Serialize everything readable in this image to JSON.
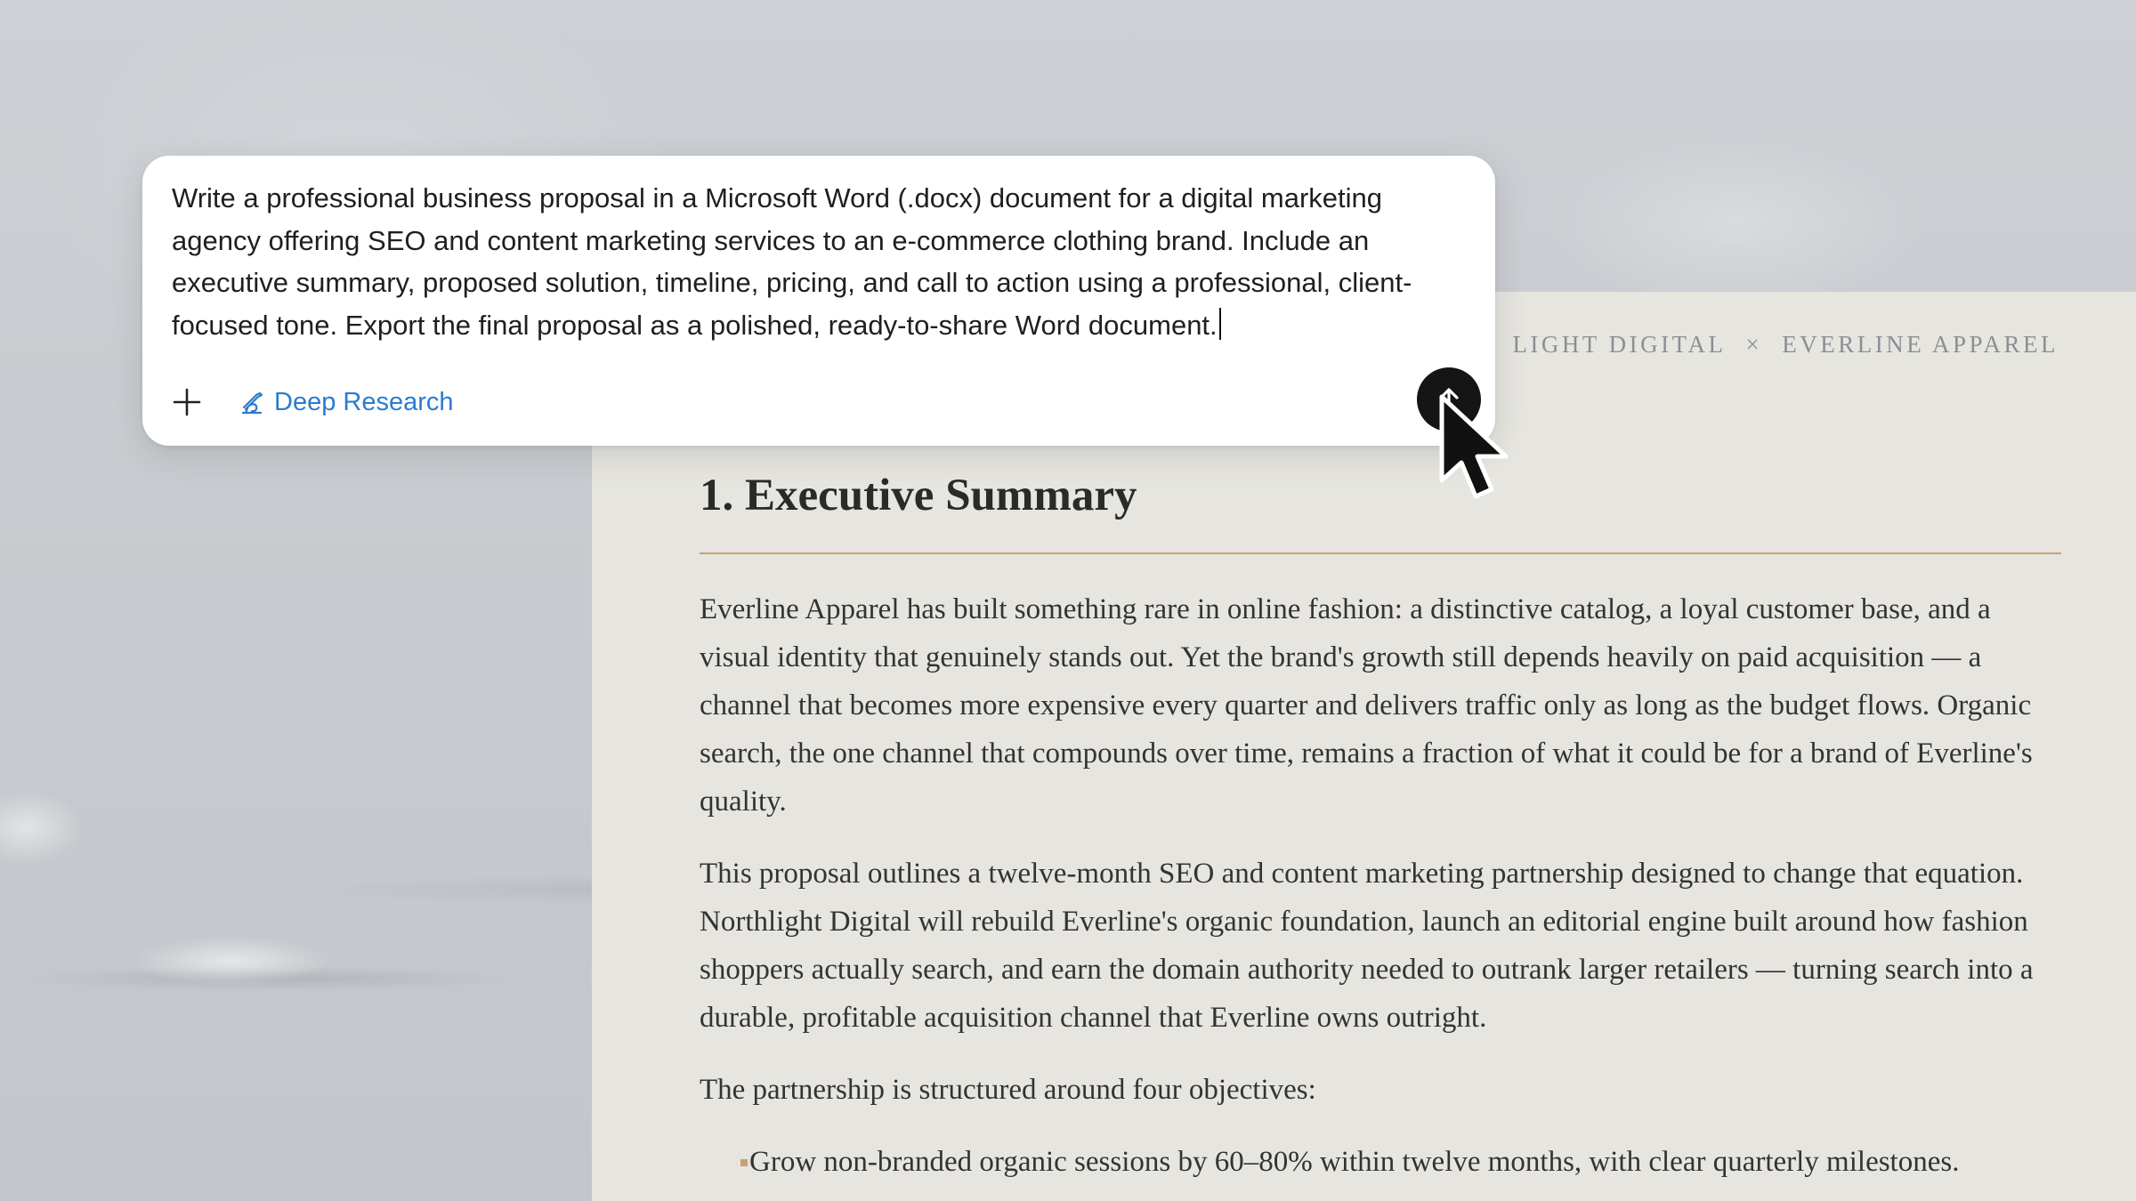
{
  "prompt": {
    "text": "Write a professional business proposal in a Microsoft Word (.docx) document for a digital marketing agency offering SEO and content marketing services to an e-commerce clothing brand. Include an executive summary, proposed solution, timeline, pricing, and call to action using a professional, client-focused tone. Export the final proposal as a polished, ready-to-share Word document.",
    "plus_icon": "plus-icon",
    "deep_research_label": "Deep Research",
    "deep_research_icon": "telescope-icon",
    "send_icon": "arrow-up-icon"
  },
  "document": {
    "header_left": "LIGHT DIGITAL",
    "header_sep": "×",
    "header_right": "EVERLINE APPAREL",
    "section_title": "1. Executive Summary",
    "paragraphs": [
      "Everline Apparel has built something rare in online fashion: a distinctive catalog, a loyal customer base, and a visual identity that genuinely stands out. Yet the brand's growth still depends heavily on paid acquisition — a channel that becomes more expensive every quarter and delivers traffic only as long as the budget flows. Organic search, the one channel that compounds over time, remains a fraction of what it could be for a brand of Everline's quality.",
      "This proposal outlines a twelve-month SEO and content marketing partnership designed to change that equation. Northlight Digital will rebuild Everline's organic foundation, launch an editorial engine built around how fashion shoppers actually search, and earn the domain authority needed to outrank larger retailers — turning search into a durable, profitable acquisition channel that Everline owns outright.",
      "The partnership is structured around four objectives:"
    ],
    "bullets": [
      "Grow non-branded organic sessions by 60–80% within twelve months, with clear quarterly milestones."
    ]
  },
  "colors": {
    "accent_rule": "#c7a26e",
    "link_blue": "#2b7bd0",
    "send_button": "#151515"
  }
}
